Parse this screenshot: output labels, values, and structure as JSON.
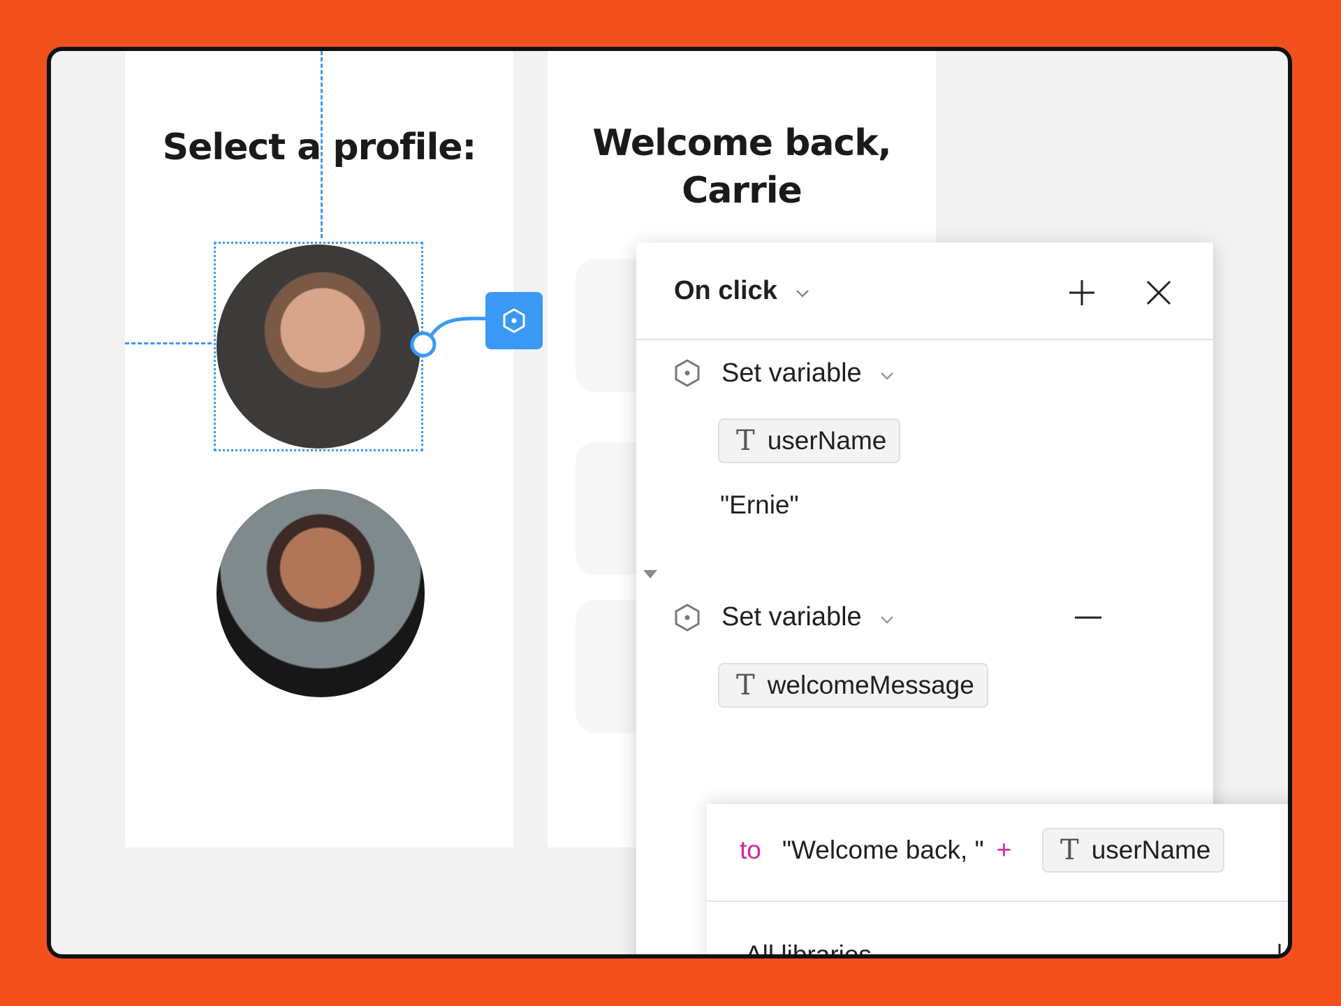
{
  "left_frame": {
    "title": "Select a profile:"
  },
  "right_frame": {
    "title_line1": "Welcome back,",
    "title_line2": "Carrie"
  },
  "interaction_panel": {
    "trigger_label": "On click",
    "actions": [
      {
        "type_label": "Set variable",
        "variable": "userName",
        "value": "\"Ernie\""
      },
      {
        "type_label": "Set variable",
        "variable": "welcomeMessage"
      }
    ]
  },
  "expression": {
    "to_keyword": "to",
    "string_literal": "\"Welcome back, \"",
    "operator": "+",
    "variable": "userName"
  },
  "library_picker": {
    "label": "All libraries"
  },
  "colors": {
    "accent": "#3C98F5",
    "background": "#F2511E",
    "keyword": "#D3279F"
  }
}
